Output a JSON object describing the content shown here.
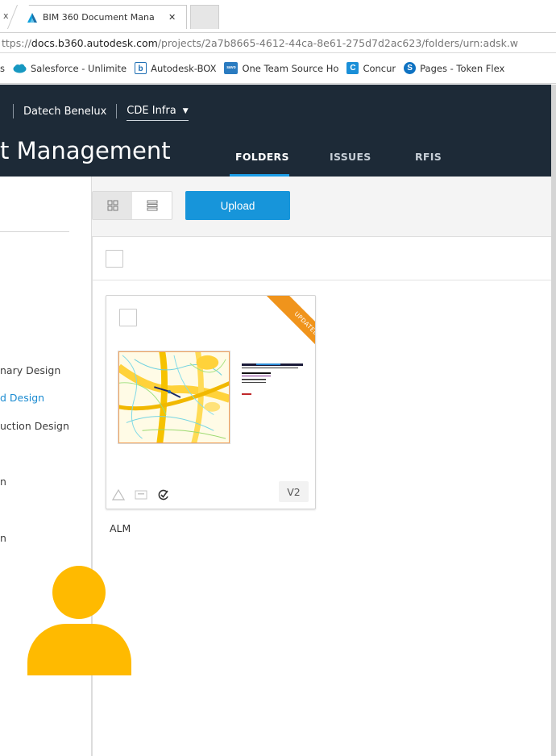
{
  "browser": {
    "prev_tab_close": "x",
    "tab_title": "BIM 360 Document Mana",
    "tab_close": "✕",
    "url_scheme": "ttps://",
    "url_host": "docs.b360.autodesk.com",
    "url_path": "/projects/2a7b8665-4612-44ca-8e61-275d7d2ac623/folders/urn:adsk.w",
    "bookmarks": [
      {
        "label": "s",
        "icon": "none"
      },
      {
        "label": "Salesforce - Unlimite",
        "icon": "salesforce-cloud-icon",
        "color": "#1798c1"
      },
      {
        "label": "Autodesk-BOX",
        "icon": "box-icon",
        "icon_text": "b",
        "color": "#1f6fb4"
      },
      {
        "label": "One Team Source Ho",
        "icon": "savo-icon",
        "icon_text": "savo",
        "color": "#2a7bc0"
      },
      {
        "label": "Concur",
        "icon": "concur-icon",
        "icon_text": "C",
        "color": "#1a8fd8"
      },
      {
        "label": "Pages - Token Flex",
        "icon": "sharepoint-icon",
        "icon_text": "S",
        "color": "#0e72c2"
      }
    ]
  },
  "header": {
    "account": "Datech Benelux",
    "project": "CDE Infra",
    "app_title": "t Management",
    "tabs": [
      {
        "label": "FOLDERS",
        "active": true
      },
      {
        "label": "ISSUES",
        "active": false
      },
      {
        "label": "RFIS",
        "active": false
      }
    ]
  },
  "sidebar": {
    "folders": [
      {
        "label": "nary Design",
        "active": false
      },
      {
        "label": "d Design",
        "active": true
      },
      {
        "label": "uction Design",
        "active": false
      },
      {
        "label": "n",
        "active": false
      },
      {
        "label": "n",
        "active": false
      }
    ]
  },
  "toolbar": {
    "upload_label": "Upload"
  },
  "card": {
    "ribbon": "UPDATED",
    "version": "V2",
    "name": "ALM"
  },
  "colors": {
    "header_bg": "#1d2a37",
    "accent_blue": "#1795da",
    "ribbon_orange": "#f0941c",
    "avatar_yellow": "#ffba00"
  }
}
